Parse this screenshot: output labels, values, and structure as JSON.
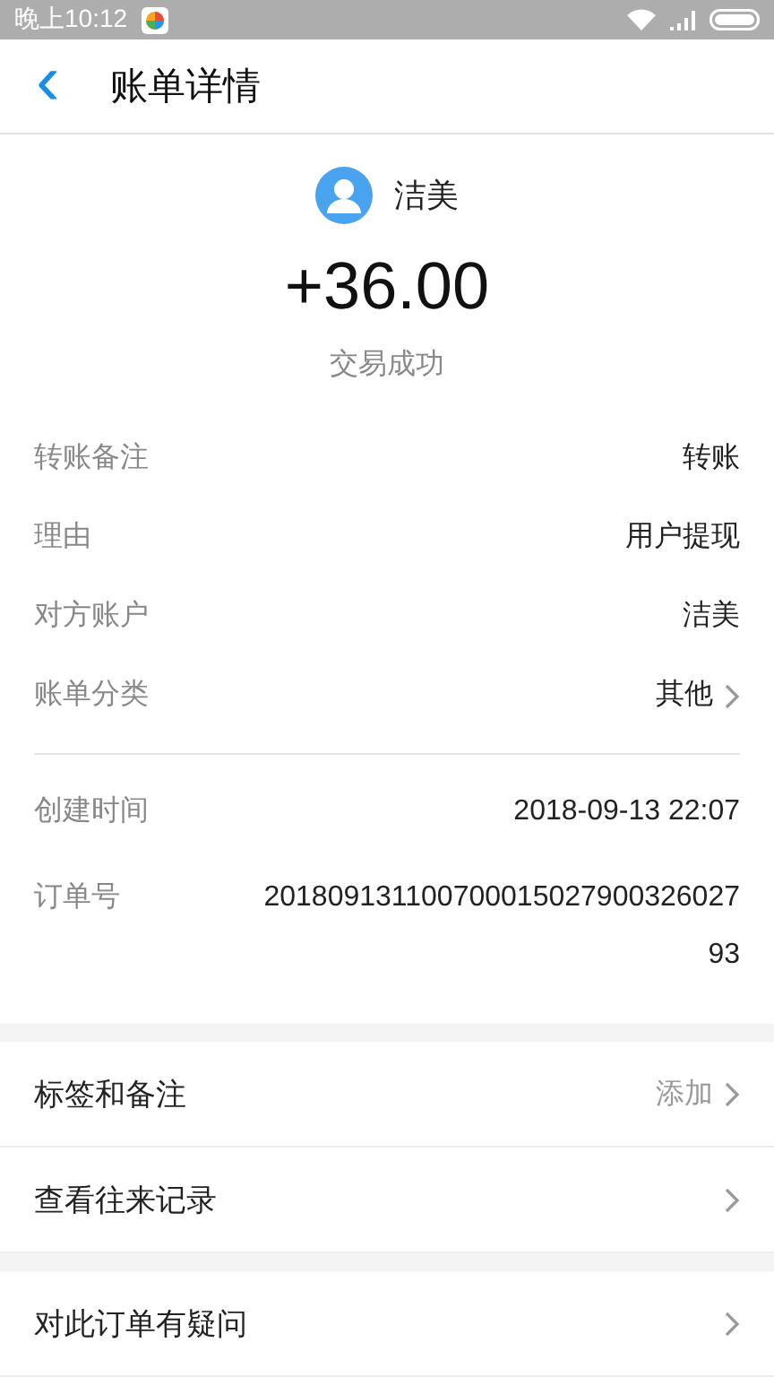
{
  "status_bar": {
    "time": "晚上10:12"
  },
  "header": {
    "back": "‹",
    "title": "账单详情"
  },
  "summary": {
    "name": "洁美",
    "amount": "+36.00",
    "status": "交易成功"
  },
  "details": [
    {
      "label": "转账备注",
      "value": "转账",
      "has_arrow": false
    },
    {
      "label": "理由",
      "value": "用户提现",
      "has_arrow": false
    },
    {
      "label": "对方账户",
      "value": "洁美",
      "has_arrow": false
    },
    {
      "label": "账单分类",
      "value": "其他",
      "has_arrow": true
    }
  ],
  "info": [
    {
      "label": "创建时间",
      "value": "2018-09-13 22:07"
    },
    {
      "label": "订单号",
      "value": "20180913110070001502790032602793"
    }
  ],
  "actions": [
    {
      "label": "标签和备注",
      "hint": "添加"
    },
    {
      "label": "查看往来记录"
    }
  ],
  "help": [
    {
      "label": "对此订单有疑问"
    }
  ]
}
